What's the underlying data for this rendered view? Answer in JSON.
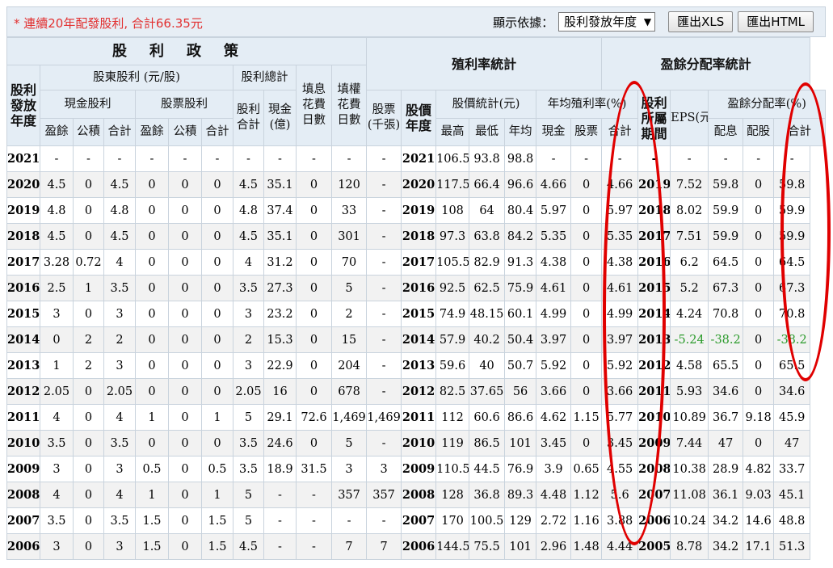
{
  "note": "* 連續20年配發股利, 合計66.35元",
  "toolbar": {
    "sort_label": "顯示依據：",
    "sort_value": "股利發放年度",
    "btn_xls": "匯出XLS",
    "btn_html": "匯出HTML"
  },
  "headers": {
    "policy": "股利政策",
    "div_year": "股利發放年度",
    "shareholder_div": "股東股利 (元/股)",
    "total_div_group": "股利總計",
    "fill_div_days": "填息花費日數",
    "fill_rights_days": "填權花費日數",
    "cash_div": "現金股利",
    "stock_div": "股票股利",
    "div_total": "股利合計",
    "cash_e": "現金(億)",
    "stock_k": "股票(千張)",
    "yield_stats": "殖利率統計",
    "price_year": "股價年度",
    "price_stats": "股價統計(元)",
    "avg_yield": "年均殖利率(%)",
    "payout_stats": "盈餘分配率統計",
    "profit_period": "股利所屬期間",
    "eps": "EPS(元)",
    "payout_rate": "盈餘分配率(%)",
    "sub": {
      "earnings": "盈餘",
      "reserve": "公積",
      "total": "合計",
      "high": "最高",
      "low": "最低",
      "avg": "年均",
      "cash": "現金",
      "stock": "股票",
      "pay_cash": "配息",
      "pay_stock": "配股"
    }
  },
  "rows": [
    [
      "2021",
      "-",
      "-",
      "-",
      "-",
      "-",
      "-",
      "-",
      "-",
      "-",
      "-",
      "-",
      "2021",
      "106.5",
      "93.8",
      "98.8",
      "-",
      "-",
      "-",
      "-",
      "-",
      "-",
      "-",
      "-"
    ],
    [
      "2020",
      "4.5",
      "0",
      "4.5",
      "0",
      "0",
      "0",
      "4.5",
      "35.1",
      "0",
      "120",
      "-",
      "2020",
      "117.5",
      "66.4",
      "96.6",
      "4.66",
      "0",
      "4.66",
      "2019",
      "7.52",
      "59.8",
      "0",
      "59.8"
    ],
    [
      "2019",
      "4.8",
      "0",
      "4.8",
      "0",
      "0",
      "0",
      "4.8",
      "37.4",
      "0",
      "33",
      "-",
      "2019",
      "108",
      "64",
      "80.4",
      "5.97",
      "0",
      "5.97",
      "2018",
      "8.02",
      "59.9",
      "0",
      "59.9"
    ],
    [
      "2018",
      "4.5",
      "0",
      "4.5",
      "0",
      "0",
      "0",
      "4.5",
      "35.1",
      "0",
      "301",
      "-",
      "2018",
      "97.3",
      "63.8",
      "84.2",
      "5.35",
      "0",
      "5.35",
      "2017",
      "7.51",
      "59.9",
      "0",
      "59.9"
    ],
    [
      "2017",
      "3.28",
      "0.72",
      "4",
      "0",
      "0",
      "0",
      "4",
      "31.2",
      "0",
      "70",
      "-",
      "2017",
      "105.5",
      "82.9",
      "91.3",
      "4.38",
      "0",
      "4.38",
      "2016",
      "6.2",
      "64.5",
      "0",
      "64.5"
    ],
    [
      "2016",
      "2.5",
      "1",
      "3.5",
      "0",
      "0",
      "0",
      "3.5",
      "27.3",
      "0",
      "5",
      "-",
      "2016",
      "92.5",
      "62.5",
      "75.9",
      "4.61",
      "0",
      "4.61",
      "2015",
      "5.2",
      "67.3",
      "0",
      "67.3"
    ],
    [
      "2015",
      "3",
      "0",
      "3",
      "0",
      "0",
      "0",
      "3",
      "23.2",
      "0",
      "2",
      "-",
      "2015",
      "74.9",
      "48.15",
      "60.1",
      "4.99",
      "0",
      "4.99",
      "2014",
      "4.24",
      "70.8",
      "0",
      "70.8"
    ],
    [
      "2014",
      "0",
      "2",
      "2",
      "0",
      "0",
      "0",
      "2",
      "15.3",
      "0",
      "15",
      "-",
      "2014",
      "57.9",
      "40.2",
      "50.4",
      "3.97",
      "0",
      "3.97",
      "2013",
      "-5.24",
      "-38.2",
      "0",
      "-38.2"
    ],
    [
      "2013",
      "1",
      "2",
      "3",
      "0",
      "0",
      "0",
      "3",
      "22.9",
      "0",
      "204",
      "-",
      "2013",
      "59.6",
      "40",
      "50.7",
      "5.92",
      "0",
      "5.92",
      "2012",
      "4.58",
      "65.5",
      "0",
      "65.5"
    ],
    [
      "2012",
      "2.05",
      "0",
      "2.05",
      "0",
      "0",
      "0",
      "2.05",
      "16",
      "0",
      "678",
      "-",
      "2012",
      "82.5",
      "37.65",
      "56",
      "3.66",
      "0",
      "3.66",
      "2011",
      "5.93",
      "34.6",
      "0",
      "34.6"
    ],
    [
      "2011",
      "4",
      "0",
      "4",
      "1",
      "0",
      "1",
      "5",
      "29.1",
      "72.6",
      "1,469",
      "1,469",
      "2011",
      "112",
      "60.6",
      "86.6",
      "4.62",
      "1.15",
      "5.77",
      "2010",
      "10.89",
      "36.7",
      "9.18",
      "45.9"
    ],
    [
      "2010",
      "3.5",
      "0",
      "3.5",
      "0",
      "0",
      "0",
      "3.5",
      "24.6",
      "0",
      "5",
      "-",
      "2010",
      "119",
      "86.5",
      "101",
      "3.45",
      "0",
      "3.45",
      "2009",
      "7.44",
      "47",
      "0",
      "47"
    ],
    [
      "2009",
      "3",
      "0",
      "3",
      "0.5",
      "0",
      "0.5",
      "3.5",
      "18.9",
      "31.5",
      "3",
      "3",
      "2009",
      "110.5",
      "44.5",
      "76.9",
      "3.9",
      "0.65",
      "4.55",
      "2008",
      "10.38",
      "28.9",
      "4.82",
      "33.7"
    ],
    [
      "2008",
      "4",
      "0",
      "4",
      "1",
      "0",
      "1",
      "5",
      "-",
      "-",
      "357",
      "357",
      "2008",
      "128",
      "36.8",
      "89.3",
      "4.48",
      "1.12",
      "5.6",
      "2007",
      "11.08",
      "36.1",
      "9.03",
      "45.1"
    ],
    [
      "2007",
      "3.5",
      "0",
      "3.5",
      "1.5",
      "0",
      "1.5",
      "5",
      "-",
      "-",
      "-",
      "-",
      "2007",
      "170",
      "100.5",
      "129",
      "2.72",
      "1.16",
      "3.88",
      "2006",
      "10.24",
      "34.2",
      "14.6",
      "48.8"
    ],
    [
      "2006",
      "3",
      "0",
      "3",
      "1.5",
      "0",
      "1.5",
      "4.5",
      "-",
      "-",
      "7",
      "7",
      "2006",
      "144.5",
      "75.5",
      "101",
      "2.96",
      "1.48",
      "4.44",
      "2005",
      "8.78",
      "34.2",
      "17.1",
      "51.3"
    ]
  ],
  "colors": {
    "header_bg": "#e4edf5",
    "note_red": "#e23030",
    "negative_green": "#2a9a2a",
    "ring_red": "#e00000"
  }
}
